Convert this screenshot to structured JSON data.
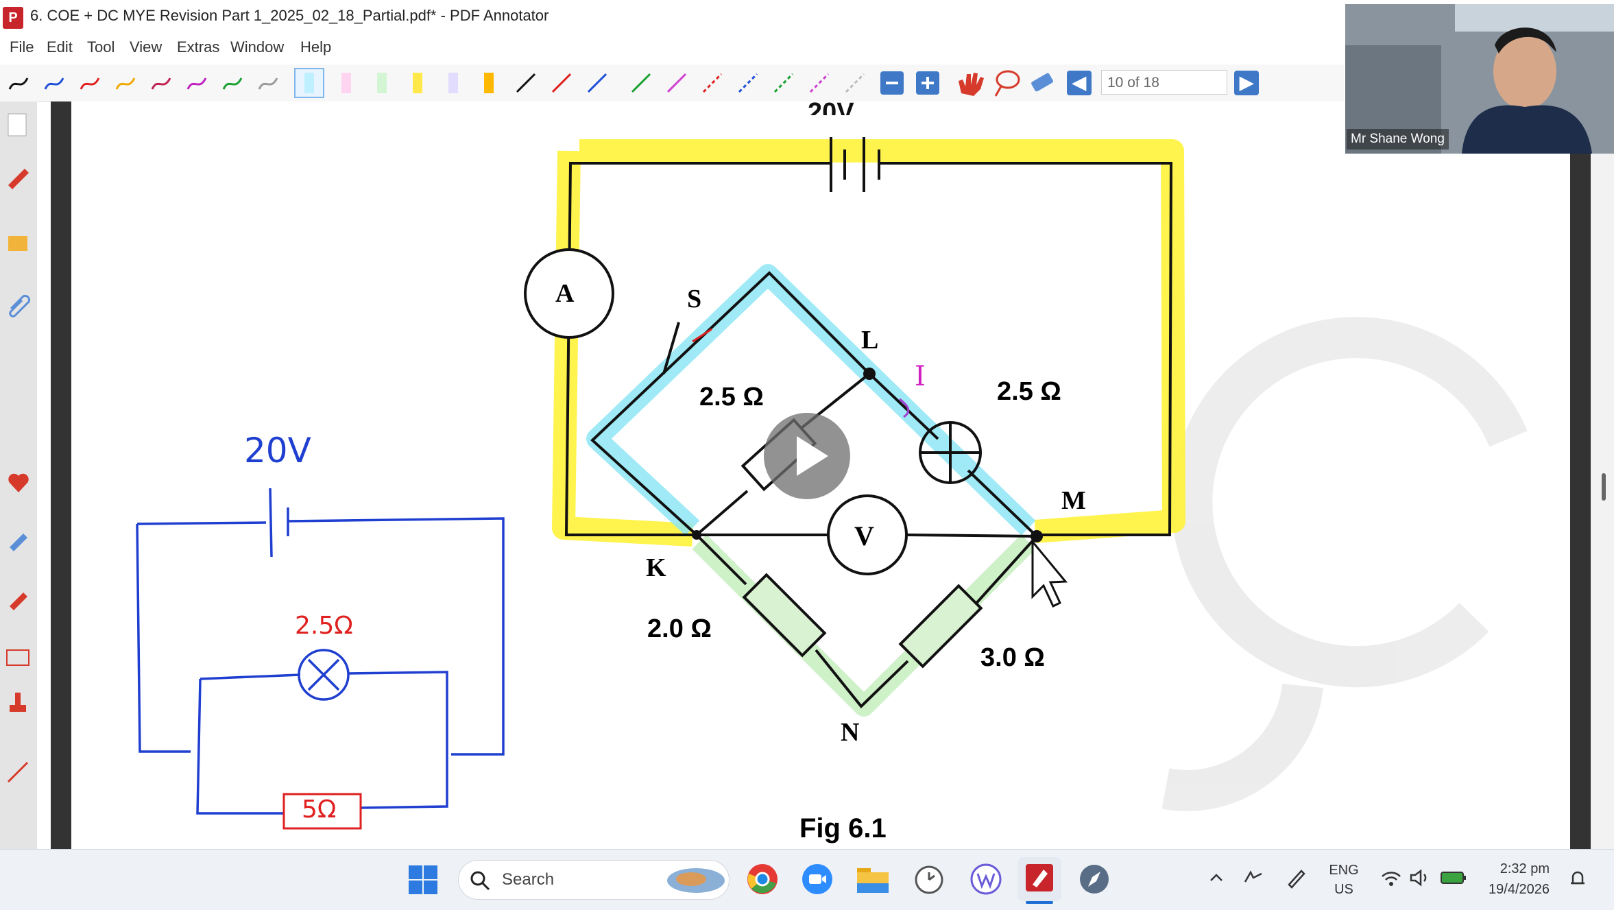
{
  "window": {
    "title": "6. COE + DC  MYE Revision Part 1_2025_02_18_Partial.pdf* - PDF Annotator"
  },
  "menu": [
    "File",
    "Edit",
    "Tool",
    "View",
    "Extras",
    "Window",
    "Help"
  ],
  "toolbar": {
    "page_indicator": "10 of 18"
  },
  "video": {
    "participant_name": "Mr Shane Wong"
  },
  "diagram": {
    "battery_label_partial": "20V",
    "nodes": [
      "S",
      "L",
      "M",
      "K",
      "N"
    ],
    "meters": [
      "A",
      "V"
    ],
    "resistors": [
      "2.5 Ω",
      "2.5 Ω",
      "2.0 Ω",
      "3.0 Ω"
    ],
    "current_label": "I",
    "caption": "Fig 6.1"
  },
  "handwritten": {
    "voltage": "20V",
    "lamp_resistance": "2.5Ω",
    "resistor": "5Ω"
  },
  "taskbar": {
    "search_placeholder": "Search",
    "language_top": "ENG",
    "language_bottom": "US",
    "time": "2:32 pm",
    "date": "19/4/2026"
  }
}
